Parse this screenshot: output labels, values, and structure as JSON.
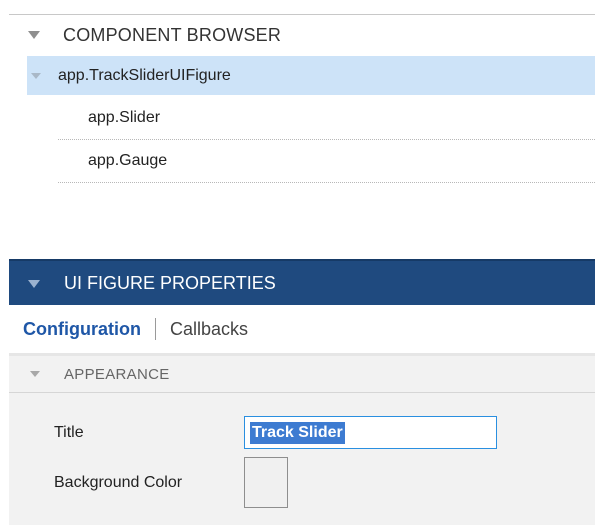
{
  "component_browser": {
    "title": "COMPONENT BROWSER",
    "tree": {
      "root": "app.TrackSliderUIFigure",
      "children": [
        "app.Slider",
        "app.Gauge"
      ]
    }
  },
  "properties": {
    "title": "UI FIGURE PROPERTIES",
    "tabs": {
      "configuration": "Configuration",
      "callbacks": "Callbacks"
    },
    "sections": {
      "appearance": {
        "title": "APPEARANCE",
        "title_label": "Title",
        "title_value": "Track Slider",
        "bg_color_label": "Background Color",
        "bg_color_value": "#f0f0f0"
      }
    }
  },
  "colors": {
    "selection": "#cde3f8",
    "header_bg": "#1f4a7f",
    "tab_active": "#1f57a7",
    "text_selection": "#3d7bd1"
  },
  "icons": {
    "collapse": "caret-down-icon"
  }
}
